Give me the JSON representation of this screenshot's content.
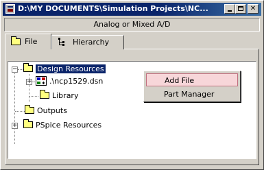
{
  "window": {
    "title": "D:\\MY DOCUMENTS\\Simulation Projects\\NC...",
    "subtitle": "Analog or Mixed A/D"
  },
  "tabs": [
    {
      "label": "File",
      "icon": "folder-icon",
      "active": true
    },
    {
      "label": "Hierarchy",
      "icon": "hierarchy-icon",
      "active": false
    }
  ],
  "tree": {
    "design_resources": "Design Resources",
    "dsn_file": ".\\ncp1529.dsn",
    "library": "Library",
    "outputs": "Outputs",
    "pspice_resources": "PSpice Resources"
  },
  "context_menu": {
    "add_file": "Add File",
    "part_manager": "Part Manager"
  },
  "colors": {
    "titlebar": "#0a246a",
    "selection": "#0a246a",
    "menu_highlight": "#f7d6d9",
    "folder": "#ffff80"
  }
}
